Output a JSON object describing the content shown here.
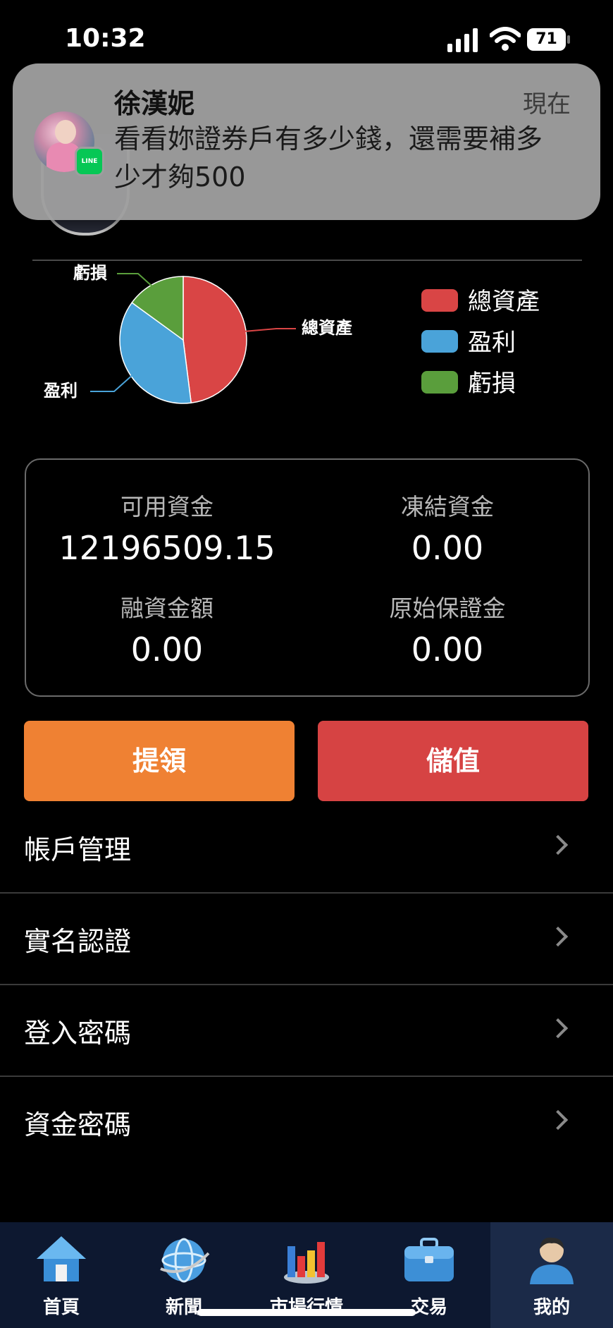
{
  "status_bar": {
    "time": "10:32",
    "battery": "71"
  },
  "notification": {
    "app": "LINE",
    "sender": "徐漢妮",
    "time": "現在",
    "message": "看看妳證券戶有多少錢，還需要補多少才夠500"
  },
  "chart_data": {
    "type": "pie",
    "title": "",
    "slices": [
      {
        "label": "總資產",
        "value": 48,
        "color": "#d94545"
      },
      {
        "label": "盈利",
        "value": 37,
        "color": "#4aa3d9"
      },
      {
        "label": "虧損",
        "value": 15,
        "color": "#5a9e3c"
      }
    ],
    "legend": {
      "placement": "right",
      "items": [
        "總資產",
        "盈利",
        "虧損"
      ]
    }
  },
  "funds": {
    "available_label": "可用資金",
    "available_value": "12196509.15",
    "frozen_label": "凍結資金",
    "frozen_value": "0.00",
    "margin_loan_label": "融資金額",
    "margin_loan_value": "0.00",
    "initial_margin_label": "原始保證金",
    "initial_margin_value": "0.00"
  },
  "actions": {
    "withdraw": "提領",
    "deposit": "儲值"
  },
  "menu": [
    {
      "label": "帳戶管理"
    },
    {
      "label": "實名認證"
    },
    {
      "label": "登入密碼"
    },
    {
      "label": "資金密碼"
    }
  ],
  "tabs": [
    {
      "label": "首頁",
      "icon": "home-icon"
    },
    {
      "label": "新聞",
      "icon": "globe-icon"
    },
    {
      "label": "市場行情",
      "icon": "bar-chart-icon"
    },
    {
      "label": "交易",
      "icon": "briefcase-icon"
    },
    {
      "label": "我的",
      "icon": "user-icon",
      "active": true
    }
  ]
}
